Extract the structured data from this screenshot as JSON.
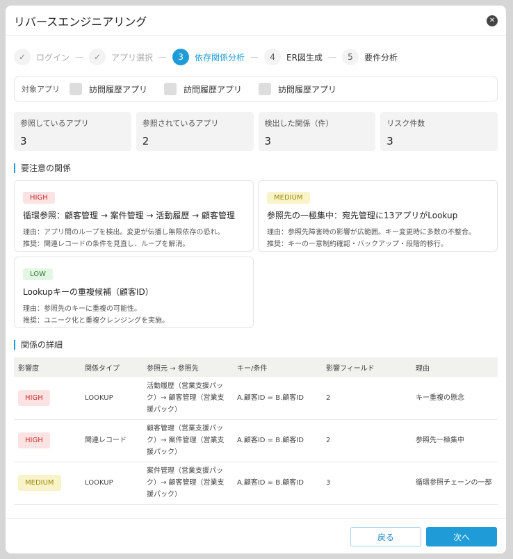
{
  "title": "リバースエンジニアリング",
  "steps": [
    {
      "n": "✓",
      "label": "ログイン"
    },
    {
      "n": "✓",
      "label": "アプリ選択"
    },
    {
      "n": "3",
      "label": "依存関係分析"
    },
    {
      "n": "4",
      "label": "ER図生成"
    },
    {
      "n": "5",
      "label": "要件分析"
    }
  ],
  "target": {
    "label": "対象アプリ",
    "apps": [
      "訪問履歴アプリ",
      "訪問履歴アプリ",
      "訪問履歴アプリ"
    ]
  },
  "stats": [
    {
      "label": "参照しているアプリ",
      "value": "3"
    },
    {
      "label": "参照されているアプリ",
      "value": "2"
    },
    {
      "label": "検出した関係（件）",
      "value": "3"
    },
    {
      "label": "リスク件数",
      "value": "3"
    }
  ],
  "attention": {
    "title": "要注意の関係",
    "cards": [
      {
        "level": "HIGH",
        "title": "循環参照：顧客管理 → 案件管理 → 活動履歴 → 顧客管理",
        "reason": "理由：アプリ間のループを検出。変更が伝播し無限依存の恐れ。",
        "rec": "推奨：関連レコードの条件を見直し、ループを解消。"
      },
      {
        "level": "MEDIUM",
        "title": "参照先の一極集中：宛先管理に13アプリがLookup",
        "reason": "理由：参照先障害時の影響が広範囲。キー変更時に多数の不整合。",
        "rec": "推奨：キーの一意制約確認・バックアップ・段階的移行。"
      },
      {
        "level": "LOW",
        "title": "Lookupキーの重複候補（顧客ID）",
        "reason": "理由：参照先のキーに重複の可能性。",
        "rec": "推奨：ユニーク化と重複クレンジングを実施。"
      }
    ]
  },
  "details": {
    "title": "関係の詳細",
    "columns": [
      "影響度",
      "関係タイプ",
      "参照元 → 参照先",
      "キー/条件",
      "影響フィールド",
      "理由"
    ],
    "rows": [
      {
        "level": "HIGH",
        "type": "LOOKUP",
        "path": "活動履歴（営業支援パック）→ 顧客管理（営業支援パック）",
        "key": "A.顧客ID = B.顧客ID",
        "fields": "2",
        "reason": "キー重複の懸念"
      },
      {
        "level": "HIGH",
        "type": "関連レコード",
        "path": "顧客管理（営業支援パック）→ 案件管理（営業支援パック）",
        "key": "A.顧客ID = B.顧客ID",
        "fields": "2",
        "reason": "参照先一極集中"
      },
      {
        "level": "MEDIUM",
        "type": "LOOKUP",
        "path": "案件管理（営業支援パック）→ 顧客管理（営業支援パック）",
        "key": "A.顧客ID = B.顧客ID",
        "fields": "3",
        "reason": "循環参照チェーンの一部"
      }
    ]
  },
  "footer": {
    "back": "戻る",
    "next": "次へ"
  }
}
